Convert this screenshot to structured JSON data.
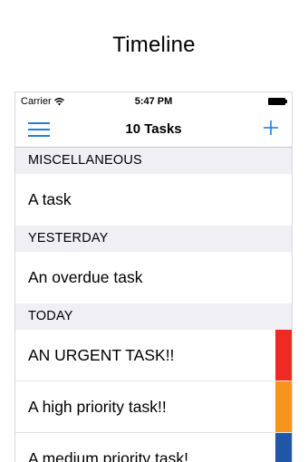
{
  "caption": "Timeline",
  "status_bar": {
    "carrier": "Carrier",
    "time": "5:47 PM"
  },
  "nav": {
    "title": "10 Tasks",
    "menu_icon": "hamburger-menu-icon",
    "add_icon": "plus-icon"
  },
  "sections": [
    {
      "header": "MISCELLANEOUS",
      "tasks": [
        {
          "label": "A task",
          "priority_color": null
        }
      ]
    },
    {
      "header": "YESTERDAY",
      "tasks": [
        {
          "label": "An overdue task",
          "priority_color": null
        }
      ]
    },
    {
      "header": "TODAY",
      "tasks": [
        {
          "label": "AN URGENT TASK!!",
          "priority_color": "#ee2a24"
        },
        {
          "label": "A high priority task!!",
          "priority_color": "#f7941d"
        },
        {
          "label": "A medium priority task!",
          "priority_color": "#1f57a6"
        }
      ]
    }
  ],
  "colors": {
    "accent": "#1a7fe0",
    "section_background": "#efeff4",
    "urgent": "#ee2a24",
    "high": "#f7941d",
    "medium": "#1f57a6"
  }
}
